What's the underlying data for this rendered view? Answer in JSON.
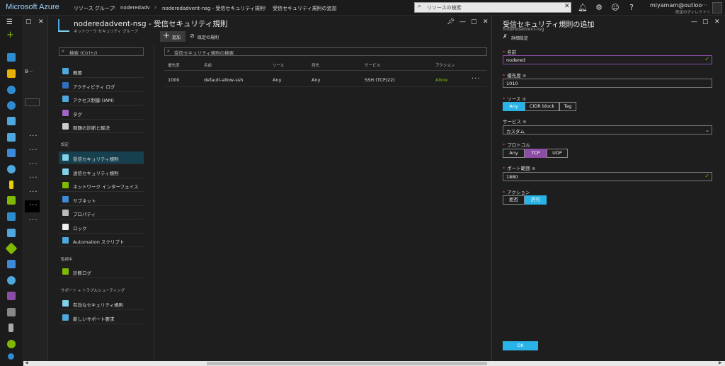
{
  "top": {
    "brand": "Microsoft Azure",
    "crumbs": [
      "リソース グループ",
      "noderedadv",
      "noderedadvent-nsg - 受信セキュリティ規則",
      "受信セキュリティ規則の追加"
    ],
    "search_placeholder": "リソースの検索",
    "user_name": "miyamam@outloo···",
    "user_dir": "既定のディレクトリ"
  },
  "blade0": {
    "peek_text": "8···"
  },
  "blade1": {
    "title": "noderedadvent-nsg - 受信セキュリティ規則",
    "subtitle": "ネットワーク セキュリティ グループ",
    "menu_search_placeholder": "検索 (Ctrl+/)",
    "menu_top": [
      {
        "label": "概要",
        "icon_color": "#4ea8de"
      },
      {
        "label": "アクティビティ ログ",
        "icon_color": "#2f6fc0"
      },
      {
        "label": "アクセス制御 (IAM)",
        "icon_color": "#4ea8de"
      },
      {
        "label": "タグ",
        "icon_color": "#a066c8"
      },
      {
        "label": "問題の診断と解決",
        "icon_color": "#cccccc"
      }
    ],
    "section_settings": "設定",
    "menu_settings": [
      {
        "label": "受信セキュリティ規則",
        "icon_color": "#7fd0e8"
      },
      {
        "label": "送信セキュリティ規則",
        "icon_color": "#7fd0e8"
      },
      {
        "label": "ネットワーク インターフェイス",
        "icon_color": "#7fba00"
      },
      {
        "label": "サブネット",
        "icon_color": "#3c8ad8"
      },
      {
        "label": "プロパティ",
        "icon_color": "#bbbbbb"
      },
      {
        "label": "ロック",
        "icon_color": "#eeeeee"
      },
      {
        "label": "Automation スクリプト",
        "icon_color": "#4ea8de"
      }
    ],
    "section_monitor": "監視中",
    "menu_monitor": [
      {
        "label": "診断ログ",
        "icon_color": "#7fba00"
      }
    ],
    "section_support": "サポート + トラブルシューティング",
    "menu_support": [
      {
        "label": "有効なセキュリティ規則",
        "icon_color": "#7fd0e8"
      },
      {
        "label": "新しいサポート要求",
        "icon_color": "#4ea8de"
      }
    ],
    "toolbar": {
      "add_label": "追加",
      "default_rules_label": "既定の規則"
    },
    "grid_search_placeholder": "受信セキュリティ規則の検索",
    "columns": [
      "優先度",
      "名前",
      "ソース",
      "宛先",
      "サービス",
      "アクション"
    ],
    "rows": [
      {
        "priority": "1000",
        "name": "default-allow-ssh",
        "source": "Any",
        "destination": "Any",
        "service": "SSH (TCP/22)",
        "action": "Allow"
      }
    ]
  },
  "blade2": {
    "title": "受信セキュリティ規則の追加",
    "subtitle": "noderedadvent-nsg",
    "advanced_label": "詳細設定",
    "fields": {
      "name_label": "名前",
      "name_value": "nodered",
      "priority_label": "優先度",
      "priority_value": "1010",
      "source_label": "ソース",
      "source_options": [
        "Any",
        "CIDR block",
        "Tag"
      ],
      "service_label": "サービス",
      "service_value": "カスタム",
      "protocol_label": "プロトコル",
      "protocol_options": [
        "Any",
        "TCP",
        "UDP"
      ],
      "port_label": "ポート範囲",
      "port_value": "1880",
      "action_label": "アクション",
      "action_options": [
        "拒否",
        "許可"
      ]
    },
    "ok_label": "OK"
  },
  "colors": {
    "accent": "#2ab3e6",
    "allow": "#7fba00",
    "protocol_selected": "#8b4da6"
  }
}
